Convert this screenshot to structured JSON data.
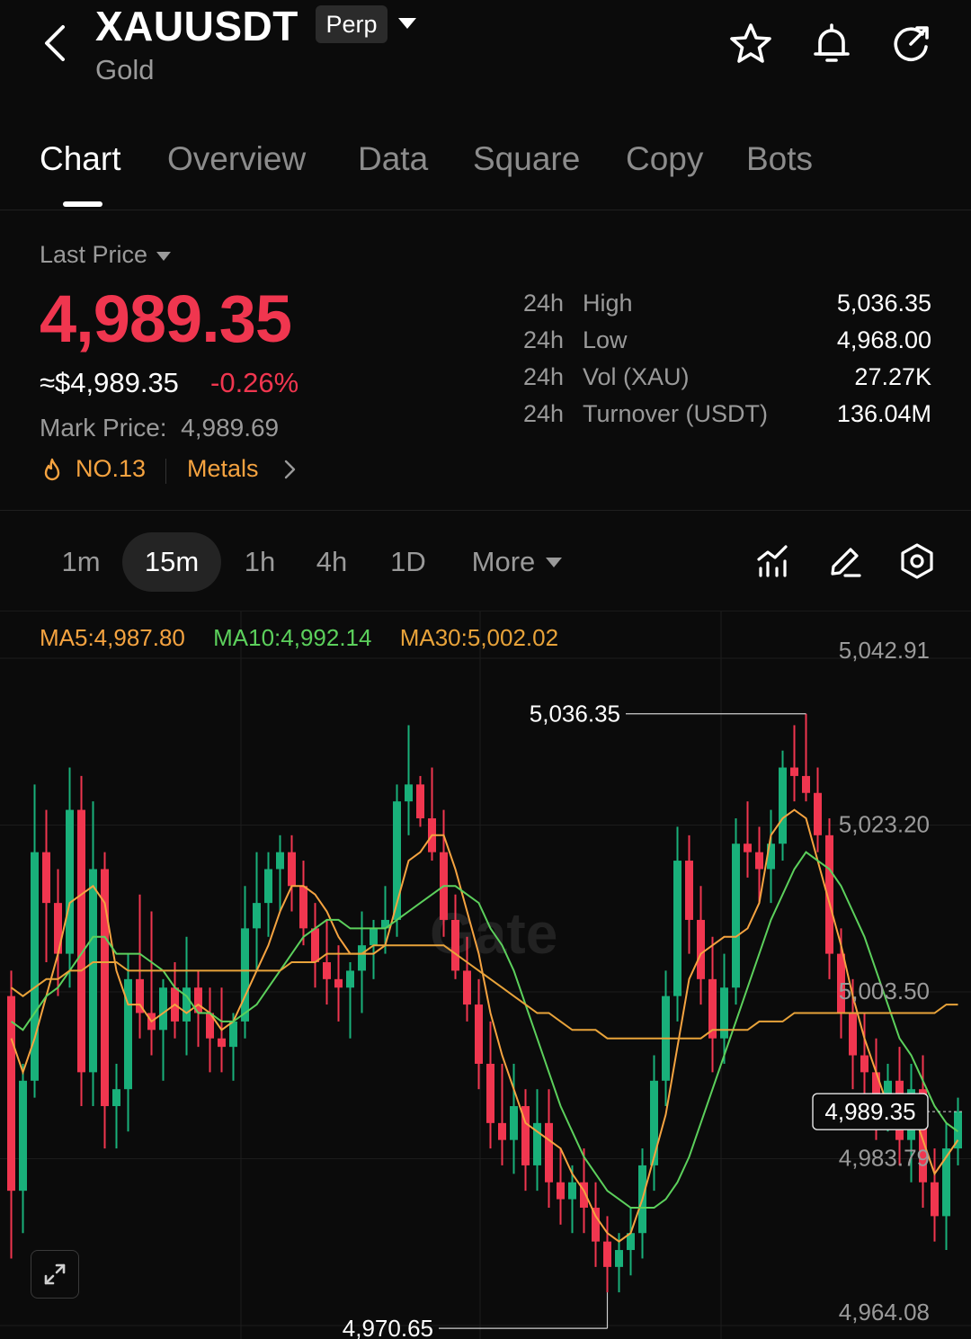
{
  "header": {
    "symbol": "XAUUSDT",
    "badge": "Perp",
    "asset_name": "Gold",
    "icons": [
      "back-icon",
      "star-icon",
      "bell-icon",
      "share-icon",
      "chevron-down-icon"
    ]
  },
  "tabs": [
    {
      "label": "Chart",
      "active": true
    },
    {
      "label": "Overview"
    },
    {
      "label": "Data"
    },
    {
      "label": "Square"
    },
    {
      "label": "Copy"
    },
    {
      "label": "Bots"
    }
  ],
  "price": {
    "label": "Last Price",
    "last": "4,989.35",
    "usd": "≈$4,989.35",
    "change": "-0.26%",
    "mark_label": "Mark Price:",
    "mark_value": "4,989.69",
    "rank": "NO.13",
    "category": "Metals",
    "up_color": "#19b07a",
    "down_color": "#f0364f"
  },
  "stats": [
    {
      "prefix": "24h",
      "label": "High",
      "value": "5,036.35"
    },
    {
      "prefix": "24h",
      "label": "Low",
      "value": "4,968.00"
    },
    {
      "prefix": "24h",
      "label": "Vol (XAU)",
      "value": "27.27K"
    },
    {
      "prefix": "24h",
      "label": "Turnover (USDT)",
      "value": "136.04M"
    }
  ],
  "intervals": [
    {
      "label": "1m"
    },
    {
      "label": "15m",
      "active": true
    },
    {
      "label": "1h"
    },
    {
      "label": "4h"
    },
    {
      "label": "1D"
    },
    {
      "label": "More"
    }
  ],
  "chart_tools": [
    "indicator-icon",
    "draw-pen-icon",
    "chart-settings-icon",
    "expand-icon"
  ],
  "ma": {
    "ma5": "MA5:4,987.80",
    "ma10": "MA10:4,992.14",
    "ma30": "MA30:5,002.02",
    "ma5_color": "#f5a340",
    "ma10_color": "#5cd05c",
    "ma30_color": "#e8a33a"
  },
  "chart_data": {
    "type": "candlestick",
    "interval": "15m",
    "ylim": [
      4964.08,
      5042.91
    ],
    "y_ticks": [
      "5,042.91",
      "5,023.20",
      "5,003.50",
      "4,983.79",
      "4,964.08"
    ],
    "current_price": "4,989.35",
    "high_marker": "5,036.35",
    "low_marker": "4,970.65",
    "watermark": "Gate",
    "candles": [
      {
        "o": 5003,
        "h": 5006,
        "l": 4972,
        "c": 4980
      },
      {
        "o": 4980,
        "h": 4995,
        "l": 4975,
        "c": 4993
      },
      {
        "o": 4993,
        "h": 5028,
        "l": 4991,
        "c": 5020
      },
      {
        "o": 5020,
        "h": 5025,
        "l": 5007,
        "c": 5014
      },
      {
        "o": 5014,
        "h": 5018,
        "l": 5003,
        "c": 5008
      },
      {
        "o": 5008,
        "h": 5030,
        "l": 5004,
        "c": 5025
      },
      {
        "o": 5025,
        "h": 5029,
        "l": 4990,
        "c": 4994
      },
      {
        "o": 4994,
        "h": 5026,
        "l": 4990,
        "c": 5018
      },
      {
        "o": 5018,
        "h": 5020,
        "l": 4985,
        "c": 4990
      },
      {
        "o": 4990,
        "h": 4995,
        "l": 4985,
        "c": 4992
      },
      {
        "o": 4992,
        "h": 5008,
        "l": 4987,
        "c": 5005
      },
      {
        "o": 5005,
        "h": 5015,
        "l": 4998,
        "c": 5001
      },
      {
        "o": 5001,
        "h": 5013,
        "l": 4996,
        "c": 4999
      },
      {
        "o": 4999,
        "h": 5005,
        "l": 4993,
        "c": 5004
      },
      {
        "o": 5004,
        "h": 5007,
        "l": 4998,
        "c": 5000
      },
      {
        "o": 5000,
        "h": 5010,
        "l": 4996,
        "c": 5004
      },
      {
        "o": 5004,
        "h": 5006,
        "l": 4997,
        "c": 5001
      },
      {
        "o": 5001,
        "h": 5004,
        "l": 4994,
        "c": 4998
      },
      {
        "o": 4998,
        "h": 5004,
        "l": 4994,
        "c": 4997
      },
      {
        "o": 4997,
        "h": 5001,
        "l": 4993,
        "c": 5000
      },
      {
        "o": 5000,
        "h": 5016,
        "l": 4998,
        "c": 5011
      },
      {
        "o": 5011,
        "h": 5020,
        "l": 5006,
        "c": 5014
      },
      {
        "o": 5014,
        "h": 5020,
        "l": 5010,
        "c": 5018
      },
      {
        "o": 5018,
        "h": 5022,
        "l": 5013,
        "c": 5020
      },
      {
        "o": 5020,
        "h": 5022,
        "l": 5013,
        "c": 5016
      },
      {
        "o": 5016,
        "h": 5019,
        "l": 5009,
        "c": 5011
      },
      {
        "o": 5011,
        "h": 5014,
        "l": 5004,
        "c": 5007
      },
      {
        "o": 5007,
        "h": 5012,
        "l": 5002,
        "c": 5005
      },
      {
        "o": 5005,
        "h": 5009,
        "l": 5000,
        "c": 5004
      },
      {
        "o": 5004,
        "h": 5007,
        "l": 4998,
        "c": 5006
      },
      {
        "o": 5006,
        "h": 5013,
        "l": 5001,
        "c": 5009
      },
      {
        "o": 5009,
        "h": 5012,
        "l": 5005,
        "c": 5011
      },
      {
        "o": 5011,
        "h": 5016,
        "l": 5008,
        "c": 5012
      },
      {
        "o": 5012,
        "h": 5028,
        "l": 5010,
        "c": 5026
      },
      {
        "o": 5026,
        "h": 5035,
        "l": 5022,
        "c": 5028
      },
      {
        "o": 5028,
        "h": 5029,
        "l": 5023,
        "c": 5024
      },
      {
        "o": 5024,
        "h": 5030,
        "l": 5019,
        "c": 5020
      },
      {
        "o": 5020,
        "h": 5025,
        "l": 5010,
        "c": 5012
      },
      {
        "o": 5012,
        "h": 5015,
        "l": 5005,
        "c": 5006
      },
      {
        "o": 5006,
        "h": 5010,
        "l": 5000,
        "c": 5002
      },
      {
        "o": 5002,
        "h": 5005,
        "l": 4992,
        "c": 4995
      },
      {
        "o": 4995,
        "h": 5000,
        "l": 4985,
        "c": 4988
      },
      {
        "o": 4988,
        "h": 4995,
        "l": 4983,
        "c": 4986
      },
      {
        "o": 4986,
        "h": 4995,
        "l": 4982,
        "c": 4990
      },
      {
        "o": 4990,
        "h": 4992,
        "l": 4980,
        "c": 4983
      },
      {
        "o": 4983,
        "h": 4992,
        "l": 4980,
        "c": 4988
      },
      {
        "o": 4988,
        "h": 4992,
        "l": 4978,
        "c": 4981
      },
      {
        "o": 4981,
        "h": 4985,
        "l": 4976,
        "c": 4979
      },
      {
        "o": 4979,
        "h": 4983,
        "l": 4975,
        "c": 4981
      },
      {
        "o": 4981,
        "h": 4985,
        "l": 4975,
        "c": 4978
      },
      {
        "o": 4978,
        "h": 4981,
        "l": 4971,
        "c": 4974
      },
      {
        "o": 4974,
        "h": 4977,
        "l": 4968,
        "c": 4971
      },
      {
        "o": 4971,
        "h": 4975,
        "l": 4968,
        "c": 4973
      },
      {
        "o": 4973,
        "h": 4978,
        "l": 4970,
        "c": 4975
      },
      {
        "o": 4975,
        "h": 4985,
        "l": 4972,
        "c": 4983
      },
      {
        "o": 4983,
        "h": 4996,
        "l": 4980,
        "c": 4993
      },
      {
        "o": 4993,
        "h": 5006,
        "l": 4990,
        "c": 5003
      },
      {
        "o": 5003,
        "h": 5023,
        "l": 5000,
        "c": 5019
      },
      {
        "o": 5019,
        "h": 5022,
        "l": 5008,
        "c": 5012
      },
      {
        "o": 5012,
        "h": 5016,
        "l": 5002,
        "c": 5005
      },
      {
        "o": 5005,
        "h": 5010,
        "l": 4994,
        "c": 4998
      },
      {
        "o": 4998,
        "h": 5008,
        "l": 4995,
        "c": 5004
      },
      {
        "o": 5004,
        "h": 5024,
        "l": 5002,
        "c": 5021
      },
      {
        "o": 5021,
        "h": 5026,
        "l": 5017,
        "c": 5020
      },
      {
        "o": 5020,
        "h": 5023,
        "l": 5014,
        "c": 5018
      },
      {
        "o": 5018,
        "h": 5025,
        "l": 5014,
        "c": 5021
      },
      {
        "o": 5021,
        "h": 5032,
        "l": 5019,
        "c": 5030
      },
      {
        "o": 5030,
        "h": 5035,
        "l": 5026,
        "c": 5029
      },
      {
        "o": 5029,
        "h": 5036.35,
        "l": 5026,
        "c": 5027
      },
      {
        "o": 5027,
        "h": 5030,
        "l": 5020,
        "c": 5022
      },
      {
        "o": 5022,
        "h": 5024,
        "l": 5005,
        "c": 5008
      },
      {
        "o": 5008,
        "h": 5011,
        "l": 4998,
        "c": 5001
      },
      {
        "o": 5001,
        "h": 5005,
        "l": 4992,
        "c": 4996
      },
      {
        "o": 4996,
        "h": 5001,
        "l": 4990,
        "c": 4994
      },
      {
        "o": 4994,
        "h": 4998,
        "l": 4986,
        "c": 4990
      },
      {
        "o": 4990,
        "h": 4995,
        "l": 4987,
        "c": 4993
      },
      {
        "o": 4993,
        "h": 4997,
        "l": 4983,
        "c": 4986
      },
      {
        "o": 4986,
        "h": 4995,
        "l": 4981,
        "c": 4992
      },
      {
        "o": 4992,
        "h": 4996,
        "l": 4978,
        "c": 4981
      },
      {
        "o": 4981,
        "h": 4985,
        "l": 4974,
        "c": 4977
      },
      {
        "o": 4977,
        "h": 4988,
        "l": 4973,
        "c": 4985
      },
      {
        "o": 4985,
        "h": 4991,
        "l": 4983,
        "c": 4989.35
      }
    ],
    "ma_series": [
      {
        "name": "MA5",
        "values": [
          4998,
          4994,
          4998,
          5003,
          5008,
          5014,
          5015,
          5016,
          5014,
          5006,
          5002,
          5002,
          5000,
          5001,
          5002,
          5001,
          5002,
          5001,
          4999,
          5000,
          5003,
          5006,
          5009,
          5013,
          5016,
          5016,
          5015,
          5013,
          5010,
          5008,
          5008,
          5008,
          5009,
          5014,
          5019,
          5020,
          5022,
          5022,
          5018,
          5013,
          5008,
          5001,
          4996,
          4992,
          4988,
          4987,
          4986,
          4985,
          4982,
          4980,
          4977,
          4975,
          4974,
          4975,
          4979,
          4984,
          4989,
          4997,
          5005,
          5008,
          5009,
          5010,
          5010,
          5011,
          5014,
          5022,
          5024,
          5025,
          5024,
          5019,
          5014,
          5009,
          5003,
          4998,
          4994,
          4990,
          4991,
          4990,
          4986,
          4982,
          4984,
          4986
        ]
      },
      {
        "name": "MA10",
        "values": [
          5000,
          4999,
          5001,
          5003,
          5004,
          5006,
          5008,
          5010,
          5010,
          5008,
          5008,
          5008,
          5007,
          5006,
          5004,
          5003,
          5001,
          5001,
          5000,
          5000,
          5001,
          5002,
          5004,
          5006,
          5008,
          5010,
          5011,
          5012,
          5012,
          5011,
          5011,
          5011,
          5011,
          5012,
          5013,
          5014,
          5015,
          5016,
          5016,
          5015,
          5014,
          5011,
          5009,
          5006,
          5002,
          4998,
          4994,
          4990,
          4987,
          4984,
          4982,
          4980,
          4979,
          4978,
          4978,
          4978,
          4979,
          4981,
          4984,
          4988,
          4992,
          4996,
          5000,
          5004,
          5008,
          5012,
          5015,
          5018,
          5020,
          5019,
          5018,
          5016,
          5013,
          5010,
          5006,
          5002,
          4998,
          4996,
          4993,
          4990,
          4988,
          4987
        ]
      },
      {
        "name": "MA30",
        "values": [
          5004,
          5003,
          5004,
          5005,
          5005,
          5006,
          5006,
          5007,
          5007,
          5007,
          5006,
          5006,
          5006,
          5006,
          5006,
          5006,
          5006,
          5006,
          5006,
          5006,
          5006,
          5006,
          5006,
          5006,
          5007,
          5007,
          5007,
          5008,
          5008,
          5008,
          5008,
          5009,
          5009,
          5009,
          5009,
          5009,
          5009,
          5009,
          5008,
          5007,
          5006,
          5005,
          5004,
          5003,
          5002,
          5001,
          5001,
          5000,
          4999,
          4999,
          4999,
          4998,
          4998,
          4998,
          4998,
          4998,
          4998,
          4998,
          4998,
          4998,
          4999,
          4999,
          4999,
          4999,
          5000,
          5000,
          5000,
          5001,
          5001,
          5001,
          5001,
          5001,
          5001,
          5001,
          5001,
          5001,
          5001,
          5001,
          5001,
          5001,
          5002,
          5002
        ]
      }
    ]
  }
}
